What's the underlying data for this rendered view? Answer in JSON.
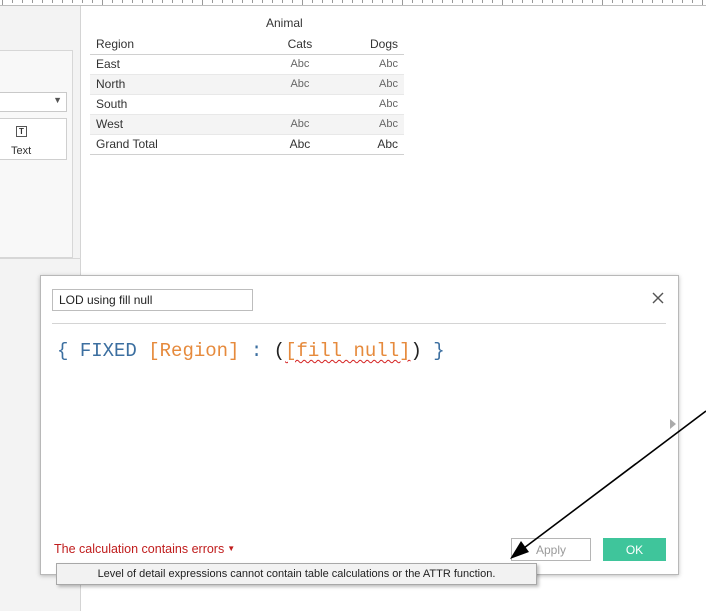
{
  "viz": {
    "column_header": "Animal",
    "row_header": "Region",
    "columns": [
      "Cats",
      "Dogs"
    ],
    "rows": [
      {
        "region": "East",
        "cats": "Abc",
        "dogs": "Abc"
      },
      {
        "region": "North",
        "cats": "Abc",
        "dogs": "Abc"
      },
      {
        "region": "South",
        "cats": "",
        "dogs": "Abc"
      },
      {
        "region": "West",
        "cats": "Abc",
        "dogs": "Abc"
      }
    ],
    "total": {
      "region": "Grand Total",
      "cats": "Abc",
      "dogs": "Abc"
    }
  },
  "marks_card": {
    "text_label": "Text",
    "text_icon": "T"
  },
  "dialog": {
    "calc_name": "LOD using fill null",
    "formula": {
      "open_brace": "{ ",
      "keyword": "FIXED",
      "field": "[Region]",
      "colon": " : ",
      "open_paren": "(",
      "error_field": "[fill null]",
      "close_paren": ")",
      "close_brace": " }"
    },
    "error_text": "The calculation contains errors",
    "apply_label": "Apply",
    "ok_label": "OK"
  },
  "tooltip": {
    "text": "Level of detail expressions cannot contain table calculations or the ATTR function."
  },
  "colors": {
    "ok_button": "#3fc59b",
    "error_text": "#c01d1d",
    "keyword": "#3c6fa0",
    "field": "#e68a3c"
  },
  "icons": {
    "close": "close-icon",
    "dropdown": "chevron-down-icon",
    "text_mark": "text-mark-icon"
  }
}
